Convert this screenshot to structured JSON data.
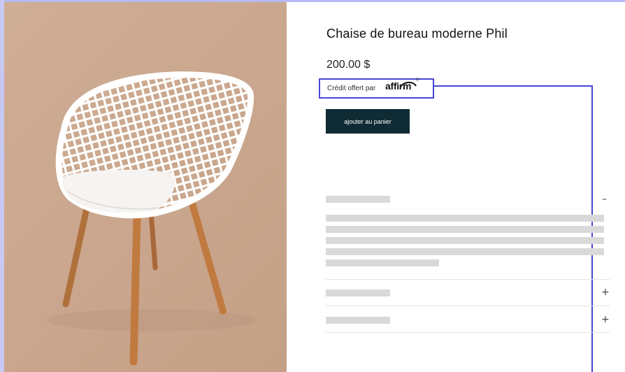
{
  "product": {
    "title": "Chaise de bureau moderne Phil",
    "price": "200.00 $",
    "financing_text": "Crédit offert par",
    "financing_brand": "affirm",
    "financing_reg": "®",
    "add_to_cart_label": "ajouter au panier"
  },
  "accordion": {
    "section_1_toggle": "–",
    "section_2_toggle": "+",
    "section_3_toggle": "+"
  },
  "colors": {
    "button_bg": "#0f2b33",
    "highlight_box": "#4848d6",
    "placeholder": "#d9d9d9",
    "image_backdrop": "#c9a68d"
  },
  "icons": [
    "minus-icon",
    "plus-icon",
    "plus-icon"
  ]
}
